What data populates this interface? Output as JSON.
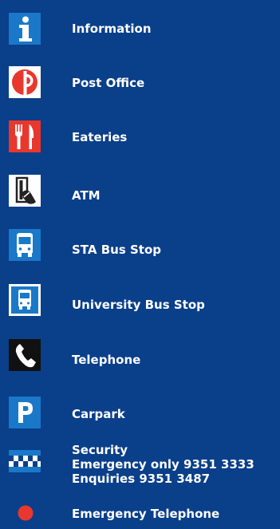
{
  "legend": {
    "items": [
      {
        "label": "Information",
        "icon": "information-icon"
      },
      {
        "label": "Post Office",
        "icon": "post-office-icon"
      },
      {
        "label": "Eateries",
        "icon": "eateries-icon"
      },
      {
        "label": "ATM",
        "icon": "atm-icon"
      },
      {
        "label": "STA Bus Stop",
        "icon": "sta-bus-icon"
      },
      {
        "label": "University Bus Stop",
        "icon": "university-bus-icon"
      },
      {
        "label": "Telephone",
        "icon": "telephone-icon"
      },
      {
        "label": "Carpark",
        "icon": "carpark-icon"
      },
      {
        "label": "Security",
        "line2": "Emergency only 9351 3333",
        "line3": "Enquiries 9351 3487",
        "icon": "security-icon"
      },
      {
        "label": "Emergency Telephone",
        "icon": "emergency-telephone-icon"
      }
    ]
  },
  "colors": {
    "background": "#0a3f8a",
    "icon_blue": "#1a78c8",
    "icon_red": "#e8372d",
    "text": "#ffffff"
  }
}
